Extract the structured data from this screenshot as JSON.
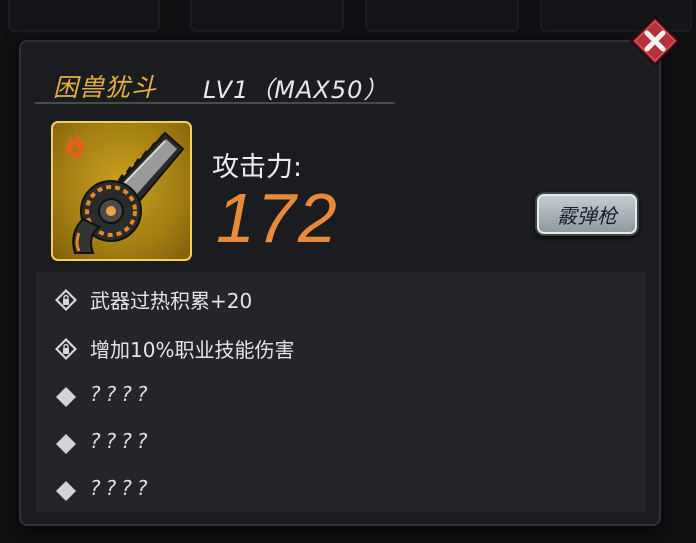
{
  "skill": {
    "name": "困兽犹斗",
    "level": "LV1（MAX50）"
  },
  "attack": {
    "label": "攻击力:",
    "value": "172"
  },
  "weapon_type_label": "霰弹枪",
  "effects": [
    {
      "text": "武器过热积累+20",
      "icon": "lock-diamond-icon"
    },
    {
      "text": "增加10%职业技能伤害",
      "icon": "lock-diamond-icon"
    },
    {
      "text": "????",
      "icon": "diamond-icon"
    },
    {
      "text": "????",
      "icon": "diamond-icon"
    },
    {
      "text": "????",
      "icon": "diamond-icon"
    }
  ],
  "colors": {
    "title": "#e3b042",
    "attack_value": "#e78a3a",
    "close_button": "#b5313a",
    "icon_frame": "#a37e12"
  }
}
